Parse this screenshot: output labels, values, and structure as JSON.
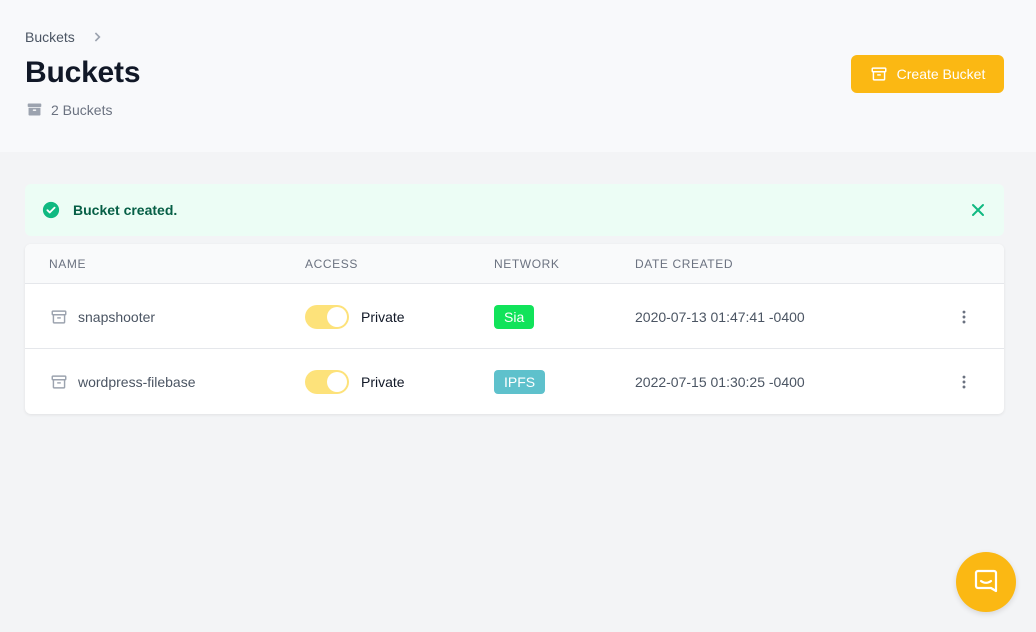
{
  "breadcrumb": {
    "item": "Buckets"
  },
  "header": {
    "title": "Buckets",
    "count_label": "2 Buckets",
    "create_button": "Create Bucket"
  },
  "alert": {
    "message": "Bucket created."
  },
  "table": {
    "columns": [
      "NAME",
      "ACCESS",
      "NETWORK",
      "DATE CREATED"
    ],
    "rows": [
      {
        "name": "snapshooter",
        "access": "Private",
        "access_enabled": true,
        "network": "Sia",
        "network_color": "#11e35a",
        "date": "2020-07-13 01:47:41 -0400"
      },
      {
        "name": "wordpress-filebase",
        "access": "Private",
        "access_enabled": true,
        "network": "IPFS",
        "network_color": "#5ec1cc",
        "date": "2022-07-15 01:30:25 -0400"
      }
    ]
  },
  "colors": {
    "accent": "#fbb813",
    "success": "#10b981",
    "toggle": "#fde27a"
  },
  "icons": {
    "breadcrumb_separator": "chevron-right-icon",
    "count": "archive-icon",
    "create": "archive-icon",
    "alert": "check-circle-icon",
    "alert_close": "close-icon",
    "bucket": "archive-icon",
    "row_menu": "more-vertical-icon",
    "chat": "chat-icon"
  }
}
